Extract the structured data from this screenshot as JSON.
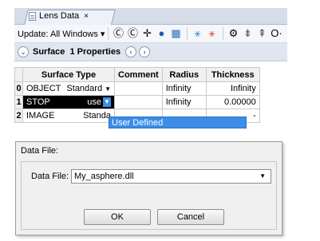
{
  "lens_window": {
    "tab_title": "Lens Data",
    "tab_close": "×",
    "toolbar": {
      "update_label": "Update: All Windows ▾",
      "icons": [
        "refresh-c-icon",
        "refresh-c-alt-icon",
        "crosshair-icon",
        "globe-icon",
        "layout-icon",
        "ray-fan-icon",
        "ray-fan-alt-icon",
        "pin-icon",
        "lens-element-icon",
        "lens-element-alt-icon",
        "circle-o-icon"
      ],
      "icon_glyphs": [
        "Ⓒ",
        "Ⓒ",
        "✛",
        "●",
        "▦",
        "⚹",
        "⚹",
        "⚙",
        "⇟",
        "⇞",
        "O·"
      ],
      "icon_colors": [
        "#000000",
        "#000000",
        "#000000",
        "#1f5fa8",
        "#2e6db5",
        "#4a90d9",
        "#d9534f",
        "#000000",
        "#555555",
        "#555555",
        "#000000"
      ]
    },
    "surface_bar": {
      "label": "Surface",
      "properties": "1 Properties",
      "prev": "‹",
      "next": "›",
      "collapse": "⌄"
    },
    "table": {
      "headers": [
        "Surface Type",
        "Comment",
        "Radius",
        "Thickness"
      ],
      "rows": [
        {
          "num": "0",
          "name": "OBJECT",
          "type": "Standard",
          "comment": "",
          "radius": "Infinity",
          "thickness": "Infinity"
        },
        {
          "num": "1",
          "name": "STOP",
          "type": "use",
          "comment": "",
          "radius": "Infinity",
          "thickness": "0.00000"
        },
        {
          "num": "2",
          "name": "IMAGE",
          "type": "Standa",
          "comment": "",
          "radius": "",
          "thickness": "-"
        }
      ]
    },
    "dropdown_popup": "User Defined"
  },
  "dialog": {
    "title": "Data File:",
    "field_label": "Data File:",
    "selected_file": "My_asphere.dll",
    "ok": "OK",
    "cancel": "Cancel"
  }
}
